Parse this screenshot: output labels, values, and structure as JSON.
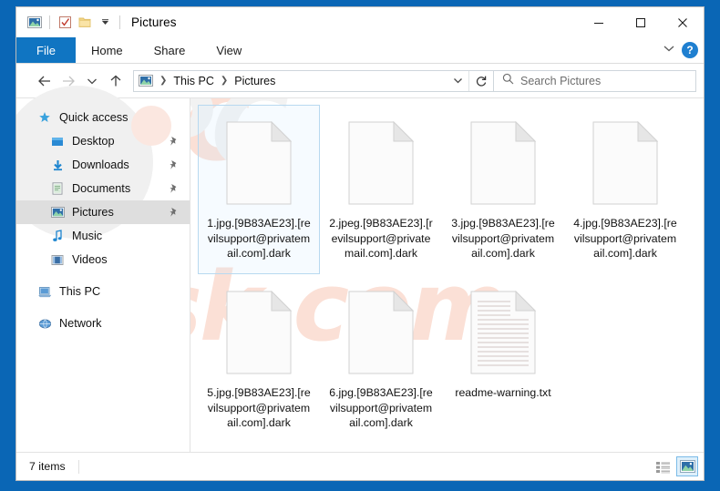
{
  "window": {
    "title": "Pictures",
    "quick_access_icons": [
      "pictures-icon",
      "properties-checkbox-icon",
      "new-folder-icon",
      "customize-chevron-icon"
    ],
    "controls": {
      "minimize": "—",
      "maximize": "□",
      "close": "✕"
    }
  },
  "ribbon": {
    "tabs": [
      {
        "label": "File",
        "active": true
      },
      {
        "label": "Home",
        "active": false
      },
      {
        "label": "Share",
        "active": false
      },
      {
        "label": "View",
        "active": false
      }
    ],
    "expand_label": "˅",
    "help_label": "?"
  },
  "address": {
    "back": "←",
    "forward": "→",
    "recent": "˅",
    "up": "↑",
    "crumbs": [
      "This PC",
      "Pictures"
    ],
    "separator": "❯",
    "dropdown": "˅",
    "refresh": "↻"
  },
  "search": {
    "placeholder": "Search Pictures",
    "icon": "search-icon"
  },
  "sidebar": {
    "items": [
      {
        "label": "Quick access",
        "icon": "star-icon",
        "indent": false,
        "pinned": false,
        "selected": false
      },
      {
        "label": "Desktop",
        "icon": "desktop-icon",
        "indent": true,
        "pinned": true,
        "selected": false
      },
      {
        "label": "Downloads",
        "icon": "downloads-icon",
        "indent": true,
        "pinned": true,
        "selected": false
      },
      {
        "label": "Documents",
        "icon": "documents-icon",
        "indent": true,
        "pinned": true,
        "selected": false
      },
      {
        "label": "Pictures",
        "icon": "pictures-icon",
        "indent": true,
        "pinned": true,
        "selected": true
      },
      {
        "label": "Music",
        "icon": "music-icon",
        "indent": true,
        "pinned": false,
        "selected": false
      },
      {
        "label": "Videos",
        "icon": "videos-icon",
        "indent": true,
        "pinned": false,
        "selected": false
      },
      {
        "label": "This PC",
        "icon": "this-pc-icon",
        "indent": false,
        "pinned": false,
        "selected": false,
        "gap_before": true
      },
      {
        "label": "Network",
        "icon": "network-icon",
        "indent": false,
        "pinned": false,
        "selected": false,
        "gap_before": true
      }
    ],
    "pin_glyph": "\u0001"
  },
  "files": [
    {
      "name": "1.jpg.[9B83AE23].[revilsupport@privatemail.com].dark",
      "type": "blank",
      "selected": true
    },
    {
      "name": "2.jpeg.[9B83AE23].[revilsupport@privatemail.com].dark",
      "type": "blank",
      "selected": false
    },
    {
      "name": "3.jpg.[9B83AE23].[revilsupport@privatemail.com].dark",
      "type": "blank",
      "selected": false
    },
    {
      "name": "4.jpg.[9B83AE23].[revilsupport@privatemail.com].dark",
      "type": "blank",
      "selected": false
    },
    {
      "name": "5.jpg.[9B83AE23].[revilsupport@privatemail.com].dark",
      "type": "blank",
      "selected": false
    },
    {
      "name": "6.jpg.[9B83AE23].[revilsupport@privatemail.com].dark",
      "type": "blank",
      "selected": false
    },
    {
      "name": "readme-warning.txt",
      "type": "text",
      "selected": false
    }
  ],
  "status": {
    "item_count": "7 items",
    "views": [
      {
        "name": "details-view",
        "active": false
      },
      {
        "name": "large-icons-view",
        "active": true
      }
    ]
  },
  "watermark": {
    "text_top": "PC",
    "text_bottom": "risk.com",
    "color_pink": "#fbe0d6",
    "color_grey": "#f2f2f2"
  },
  "colors": {
    "accent": "#0a66b5",
    "tab_active": "#1075c2",
    "selection": "#dedede",
    "tile_selected_border": "#b8d9f0"
  }
}
